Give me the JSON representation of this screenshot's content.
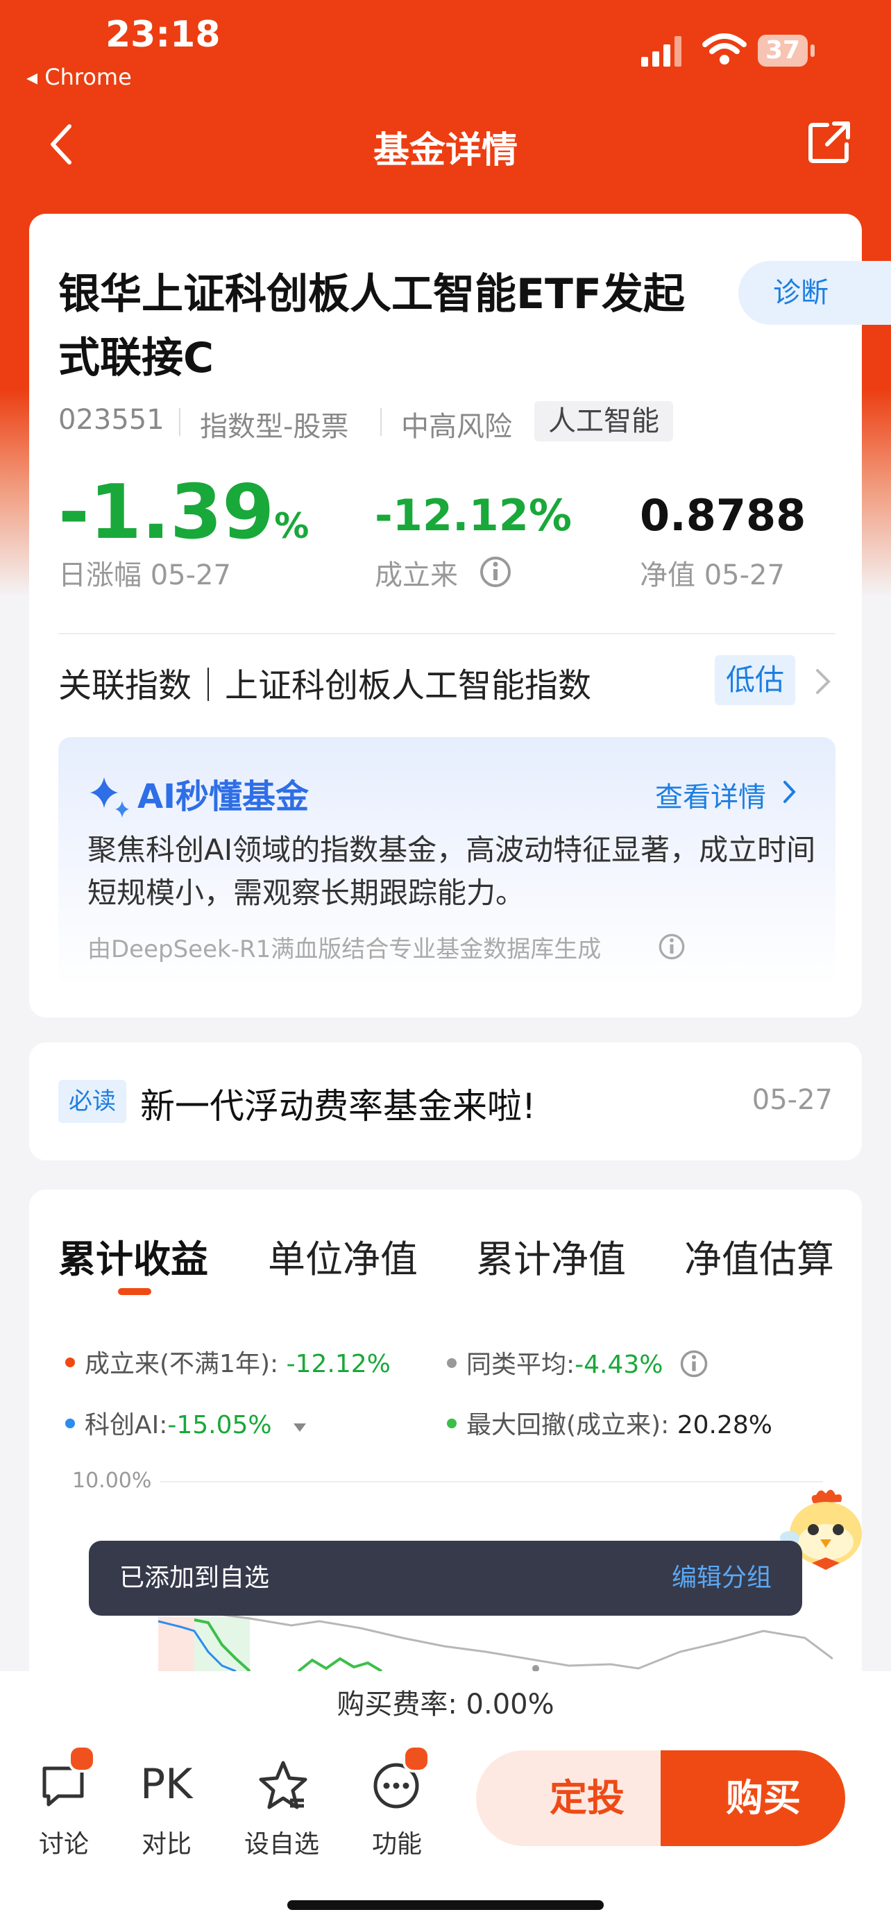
{
  "status_bar": {
    "time": "23:18",
    "back_app": "◂ Chrome",
    "battery": "37"
  },
  "nav": {
    "title": "基金详情"
  },
  "fund": {
    "name": "银华上证科创板人工智能ETF发起式联接C",
    "diagnose_label": "诊断",
    "code": "023551",
    "type": "指数型-股票",
    "risk": "中高风险",
    "tag": "人工智能",
    "day_change_value": "-1.39",
    "day_change_unit": "%",
    "day_change_label": "日涨幅 05-27",
    "since_inception_value": "-12.12%",
    "since_inception_label": "成立来",
    "nav_value": "0.8788",
    "nav_label": "净值 05-27"
  },
  "related_index": {
    "label": "关联指数｜上证科创板人工智能指数",
    "valuation": "低估"
  },
  "ai": {
    "title": "AI秒懂基金",
    "link": "查看详情",
    "text": "聚焦科创AI领域的指数基金，高波动特征显著，成立时间短规模小，需观察长期跟踪能力。",
    "footnote": "由DeepSeek-R1满血版结合专业基金数据库生成"
  },
  "notice": {
    "badge": "必读",
    "text": "新一代浮动费率基金来啦!",
    "date": "05-27"
  },
  "tabs": [
    {
      "label": "累计收益",
      "active": true
    },
    {
      "label": "单位净值",
      "active": false
    },
    {
      "label": "累计净值",
      "active": false
    },
    {
      "label": "净值估算",
      "active": false
    }
  ],
  "legend": {
    "since_label": "成立来(不满1年):",
    "since_value": "-12.12%",
    "peer_label": "同类平均:",
    "peer_value": "-4.43%",
    "index_label": "科创AI:",
    "index_value": "-15.05%",
    "drawdown_label": "最大回撤(成立来):",
    "drawdown_value": "20.28%"
  },
  "chart": {
    "y_tick_top": "10.00%"
  },
  "toast": {
    "text": "已添加到自选",
    "action": "编辑分组"
  },
  "fee": {
    "text": "购买费率: 0.00%"
  },
  "bottom_bar": {
    "discuss": "讨论",
    "compare_icon_text": "PK",
    "compare": "对比",
    "watchlist": "设自选",
    "functions": "功能",
    "auto_invest": "定投",
    "buy": "购买"
  },
  "colors": {
    "brand": "#ec3e12",
    "down_green": "#19a83a",
    "link_blue": "#1d7ee0"
  }
}
